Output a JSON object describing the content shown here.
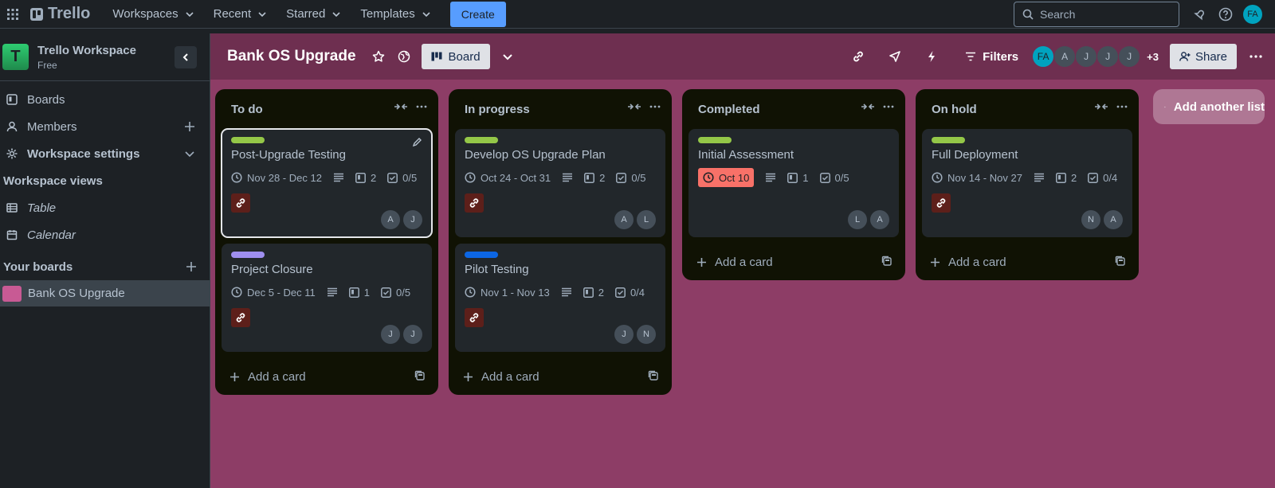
{
  "topbar": {
    "brand": "Trello",
    "nav": [
      "Workspaces",
      "Recent",
      "Starred",
      "Templates"
    ],
    "create_label": "Create",
    "search_placeholder": "Search",
    "user_initials": "FA"
  },
  "sidebar": {
    "workspace_initial": "T",
    "workspace_name": "Trello Workspace",
    "workspace_plan": "Free",
    "items": [
      {
        "label": "Boards",
        "icon": "board-icon"
      },
      {
        "label": "Members",
        "icon": "person-icon"
      },
      {
        "label": "Workspace settings",
        "icon": "gear-icon"
      }
    ],
    "views_heading": "Workspace views",
    "views": [
      {
        "label": "Table",
        "icon": "table-icon"
      },
      {
        "label": "Calendar",
        "icon": "calendar-icon"
      }
    ],
    "boards_heading": "Your boards",
    "boards": [
      "Bank OS Upgrade"
    ]
  },
  "board": {
    "title": "Bank OS Upgrade",
    "view_label": "Board",
    "filters_label": "Filters",
    "members": [
      "FA",
      "A",
      "J",
      "J",
      "J"
    ],
    "more_members": "+3",
    "share_label": "Share"
  },
  "lists": [
    {
      "title": "To do",
      "add_label": "Add a card",
      "cards": [
        {
          "label_color": "#94c748",
          "title": "Post-Upgrade Testing",
          "dates": "Nov 28 - Dec 12",
          "attachments": "2",
          "checklist": "0/5",
          "members": [
            "A",
            "J"
          ],
          "selected": true
        },
        {
          "label_color": "#9f8fef",
          "title": "Project Closure",
          "dates": "Dec 5 - Dec 11",
          "attachments": "1",
          "checklist": "0/5",
          "members": [
            "J",
            "J"
          ],
          "selected": false
        }
      ]
    },
    {
      "title": "In progress",
      "add_label": "Add a card",
      "cards": [
        {
          "label_color": "#94c748",
          "title": "Develop OS Upgrade Plan",
          "dates": "Oct 24 - Oct 31",
          "attachments": "2",
          "checklist": "0/5",
          "members": [
            "A",
            "L"
          ],
          "selected": false
        },
        {
          "label_color": "#0c66e4",
          "title": "Pilot Testing",
          "dates": "Nov 1 - Nov 13",
          "attachments": "2",
          "checklist": "0/4",
          "members": [
            "J",
            "N"
          ],
          "selected": false
        }
      ]
    },
    {
      "title": "Completed",
      "add_label": "Add a card",
      "cards": [
        {
          "label_color": "#94c748",
          "title": "Initial Assessment",
          "dates": "Oct 10",
          "overdue": true,
          "attachments": "1",
          "checklist": "0/5",
          "members": [
            "L",
            "A"
          ],
          "selected": false
        }
      ]
    },
    {
      "title": "On hold",
      "add_label": "Add a card",
      "cards": [
        {
          "label_color": "#94c748",
          "title": "Full Deployment",
          "dates": "Nov 14 - Nov 27",
          "attachments": "2",
          "checklist": "0/4",
          "members": [
            "N",
            "A"
          ],
          "selected": false
        }
      ]
    }
  ],
  "add_list_label": "Add another list"
}
